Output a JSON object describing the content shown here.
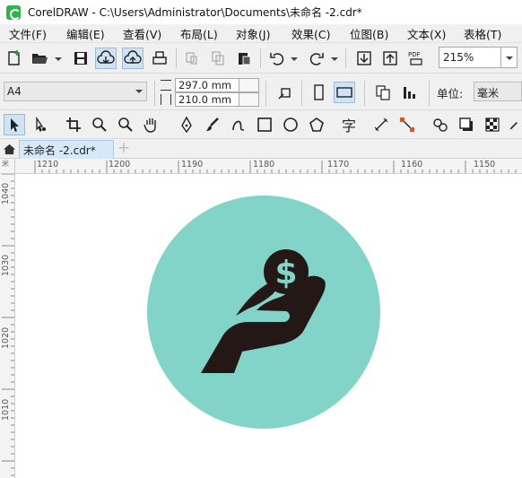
{
  "window": {
    "title": "CorelDRAW - C:\\Users\\Administrator\\Documents\\未命名 -2.cdr*"
  },
  "menu": [
    "文件(F)",
    "编辑(E)",
    "查看(V)",
    "布局(L)",
    "对象(J)",
    "效果(C)",
    "位图(B)",
    "文本(X)",
    "表格(T)"
  ],
  "toolbar": {
    "zoom_value": "215%",
    "pdf_label": "PDF"
  },
  "property_bar": {
    "page_size": "A4",
    "width": "297.0 mm",
    "height": "210.0 mm",
    "unit_label": "单位:",
    "unit_value": "毫米"
  },
  "toolbox": {
    "text_tool_glyph": "字"
  },
  "tabs": {
    "document": "未命名 -2.cdr*",
    "add": "+"
  },
  "rulers": {
    "horizontal": [
      "1210",
      "1200",
      "1190",
      "1180",
      "1170",
      "1160",
      "1150"
    ],
    "vertical": [
      "1040",
      "1030",
      "1020",
      "1010"
    ],
    "corner": "米"
  },
  "artwork": {
    "circle_color": "#83d4c8",
    "icon_color": "#231815",
    "symbol": "$"
  }
}
